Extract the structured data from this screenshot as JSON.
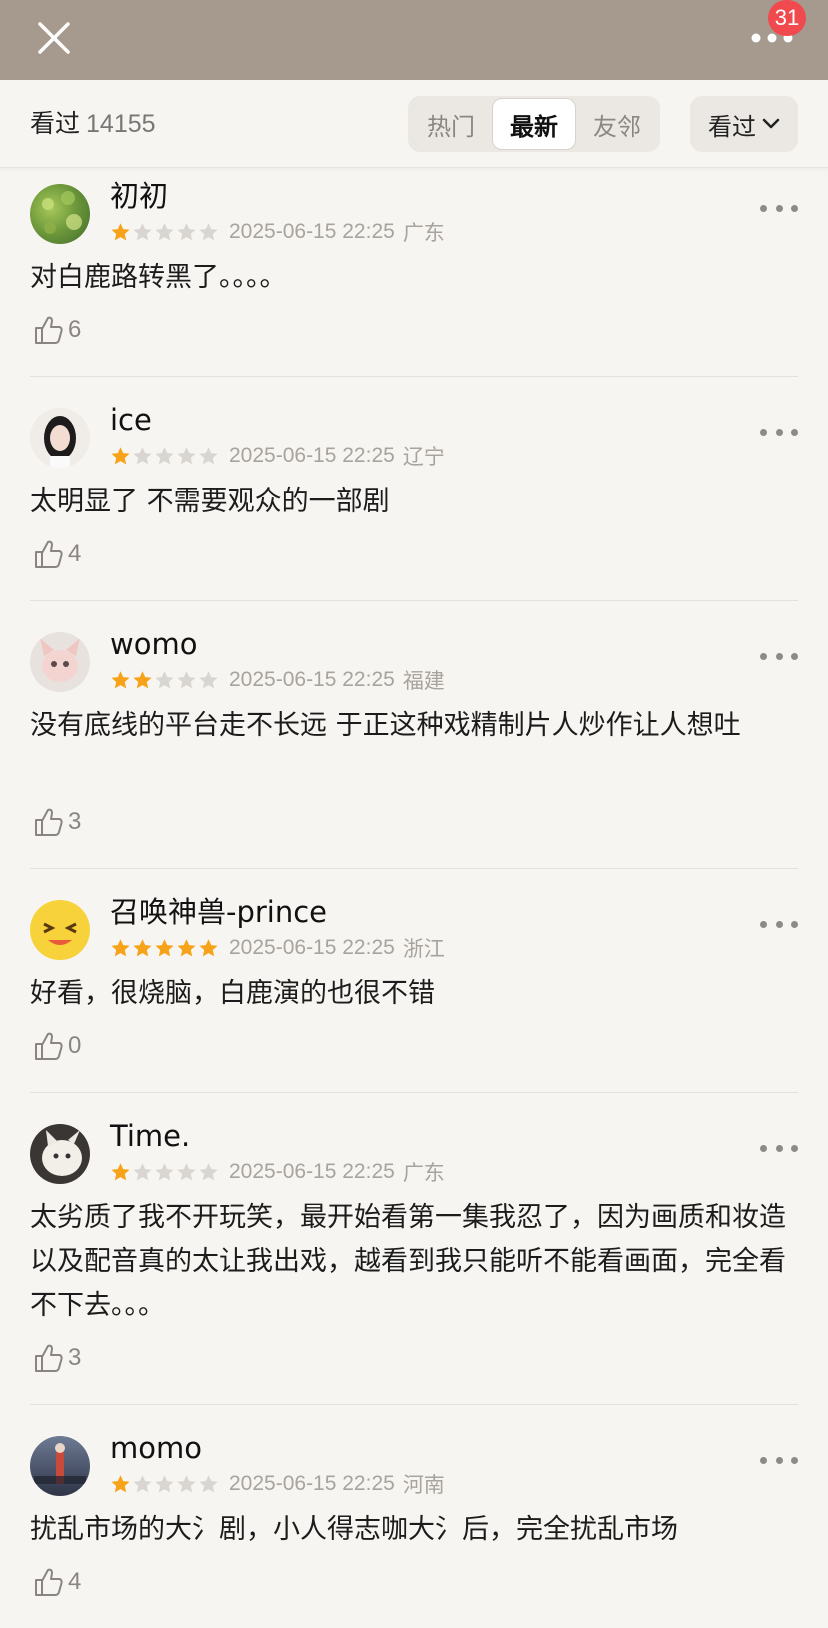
{
  "header": {
    "notification_count": "31"
  },
  "filter": {
    "watched_label": "看过",
    "watched_count": "14155",
    "tabs": [
      "热门",
      "最新",
      "友邻"
    ],
    "active_tab": "最新",
    "dropdown_label": "看过"
  },
  "colors": {
    "star_on": "#f7a31a",
    "star_off": "#d9d6d1",
    "badge": "#f04a4f",
    "header_bg": "#a69a8f"
  },
  "comments": [
    {
      "user": "初初",
      "rating": 1,
      "date": "2025-06-15 22:25",
      "location": "广东",
      "text": "对白鹿路转黑了。。。。",
      "likes": "6"
    },
    {
      "user": "ice",
      "rating": 1,
      "date": "2025-06-15 22:25",
      "location": "辽宁",
      "text": "太明显了 不需要观众的一部剧",
      "likes": "4"
    },
    {
      "user": "womo",
      "rating": 2,
      "date": "2025-06-15 22:25",
      "location": "福建",
      "text": "没有底线的平台走不长远 于正这种戏精制片人炒作让人想吐",
      "likes": "3"
    },
    {
      "user": "召唤神兽-prince",
      "rating": 5,
      "date": "2025-06-15 22:25",
      "location": "浙江",
      "text": "好看，很烧脑，白鹿演的也很不错",
      "likes": "0"
    },
    {
      "user": "Time.",
      "rating": 1,
      "date": "2025-06-15 22:25",
      "location": "广东",
      "text": "太劣质了我不开玩笑，最开始看第一集我忍了，因为画质和妆造以及配音真的太让我出戏，越看到我只能听不能看画面，完全看不下去。。。",
      "likes": "3"
    },
    {
      "user": "momo",
      "rating": 1,
      "date": "2025-06-15 22:25",
      "location": "河南",
      "text": "扰乱市场的大氵剧，小人得志咖大氵后，完全扰乱市场",
      "likes": "4"
    }
  ]
}
